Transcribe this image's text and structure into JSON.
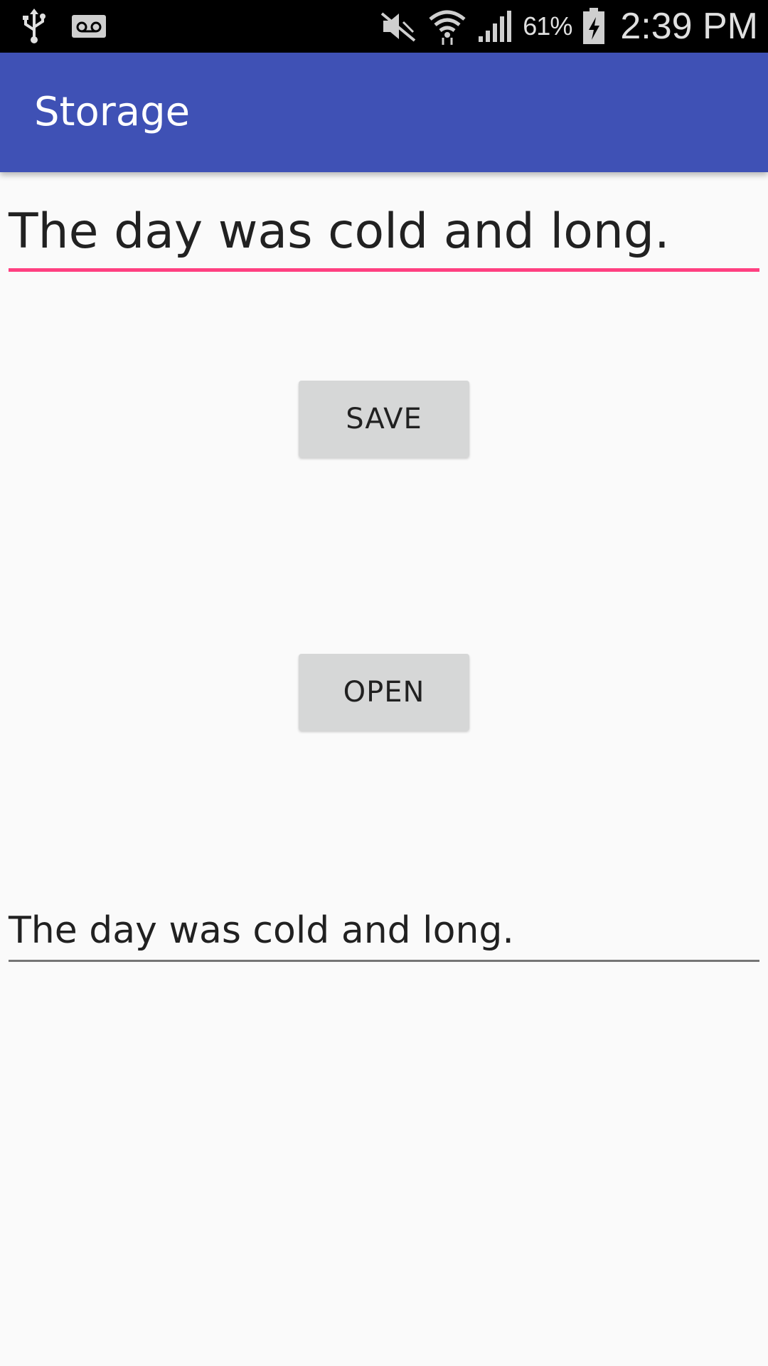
{
  "status_bar": {
    "icons_left": [
      "usb-icon",
      "voicemail-icon"
    ],
    "icons_right": [
      "mute-icon",
      "wifi-icon",
      "signal-icon",
      "battery-charging-icon"
    ],
    "battery_percent": "61%",
    "time": "2:39 PM"
  },
  "app_bar": {
    "title": "Storage",
    "color": "#3f51b5"
  },
  "input_text": {
    "value": "The day was cold and long.",
    "accent_color": "#ff4081"
  },
  "buttons": {
    "save_label": "SAVE",
    "open_label": "OPEN"
  },
  "output_text": {
    "value": "The day was cold and long."
  }
}
